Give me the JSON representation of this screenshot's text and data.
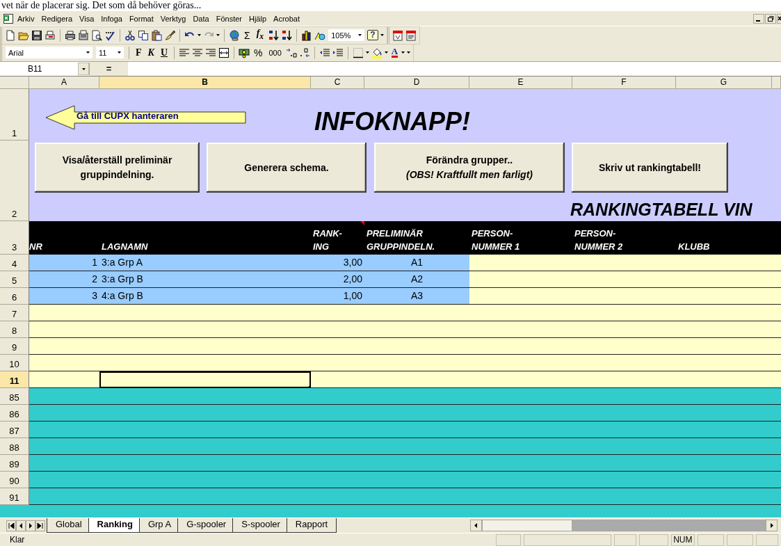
{
  "document_text": "vet när de placerar sig. Det som då behöver göras...",
  "menu": [
    "Arkiv",
    "Redigera",
    "Visa",
    "Infoga",
    "Format",
    "Verktyg",
    "Data",
    "Fönster",
    "Hjälp",
    "Acrobat"
  ],
  "standard_toolbar": {
    "sum": "Σ",
    "function": "f$_{x}$",
    "zoom": "105%",
    "help": "?"
  },
  "formatting_toolbar": {
    "font": "Arial",
    "size": "11",
    "bold": "F",
    "italic": "K",
    "underline": "U",
    "percent": "%",
    "thousands": "000",
    "font_color": "A"
  },
  "formula_bar": {
    "name_box": "B11",
    "label": "="
  },
  "columns": [
    {
      "label": "A",
      "selected": false
    },
    {
      "label": "B",
      "selected": true
    },
    {
      "label": "C",
      "selected": false
    },
    {
      "label": "D",
      "selected": false
    },
    {
      "label": "E",
      "selected": false
    },
    {
      "label": "F",
      "selected": false
    },
    {
      "label": "G",
      "selected": false
    }
  ],
  "banner": {
    "row_1": "1",
    "row_2": "2",
    "arrow_label": "Gå till CUPX hanteraren",
    "title": "INFOKNAPP!",
    "buttons": [
      {
        "lines": [
          "Visa/återställ preliminär",
          "gruppindelning."
        ]
      },
      {
        "lines": [
          "Generera schema."
        ]
      },
      {
        "lines": [
          "Förändra grupper..",
          "*(OBS! Kraftfullt men farligt)*"
        ]
      },
      {
        "lines": [
          "Skriv ut rankingtabell!"
        ]
      }
    ],
    "subtitle": "RANKINGTABELL VIN"
  },
  "header_row": {
    "number": "3",
    "cells": [
      [
        "NR"
      ],
      [
        "LAGNAMN"
      ],
      [
        "RANK-",
        "ING"
      ],
      [
        "PRELIMINÄR",
        "GRUPPINDELN."
      ],
      [
        "PERSON-",
        "NUMMER 1"
      ],
      [
        "PERSON-",
        "NUMMER 2"
      ],
      [
        "KLUBB"
      ]
    ]
  },
  "rows": [
    {
      "number": "4",
      "kind": "team",
      "selected": false,
      "cells": [
        "1",
        "3:a Grp A",
        "3,00",
        "A1"
      ]
    },
    {
      "number": "5",
      "kind": "team",
      "selected": false,
      "cells": [
        "2",
        "3:a Grp B",
        "2,00",
        "A2"
      ]
    },
    {
      "number": "6",
      "kind": "team",
      "selected": false,
      "cells": [
        "3",
        "4:a Grp B",
        "1,00",
        "A3"
      ]
    },
    {
      "number": "7",
      "kind": "blank",
      "selected": false
    },
    {
      "number": "8",
      "kind": "blank",
      "selected": false
    },
    {
      "number": "9",
      "kind": "blank",
      "selected": false
    },
    {
      "number": "10",
      "kind": "blank",
      "selected": false
    },
    {
      "number": "11",
      "kind": "blank",
      "selected": true
    },
    {
      "number": "85",
      "kind": "band",
      "selected": false
    },
    {
      "number": "86",
      "kind": "band",
      "selected": false
    },
    {
      "number": "87",
      "kind": "band",
      "selected": false
    },
    {
      "number": "88",
      "kind": "band",
      "selected": false
    },
    {
      "number": "89",
      "kind": "band",
      "selected": false
    },
    {
      "number": "90",
      "kind": "band",
      "selected": false
    },
    {
      "number": "91",
      "kind": "band",
      "selected": false
    }
  ],
  "sheet_tabs": [
    {
      "label": "Global",
      "selected": false
    },
    {
      "label": "Ranking",
      "selected": true
    },
    {
      "label": "Grp A",
      "selected": false
    },
    {
      "label": "G-spooler",
      "selected": false
    },
    {
      "label": "S-spooler",
      "selected": false
    },
    {
      "label": "Rapport",
      "selected": false
    }
  ],
  "status_bar": {
    "text": "Klar",
    "num": "NUM"
  }
}
